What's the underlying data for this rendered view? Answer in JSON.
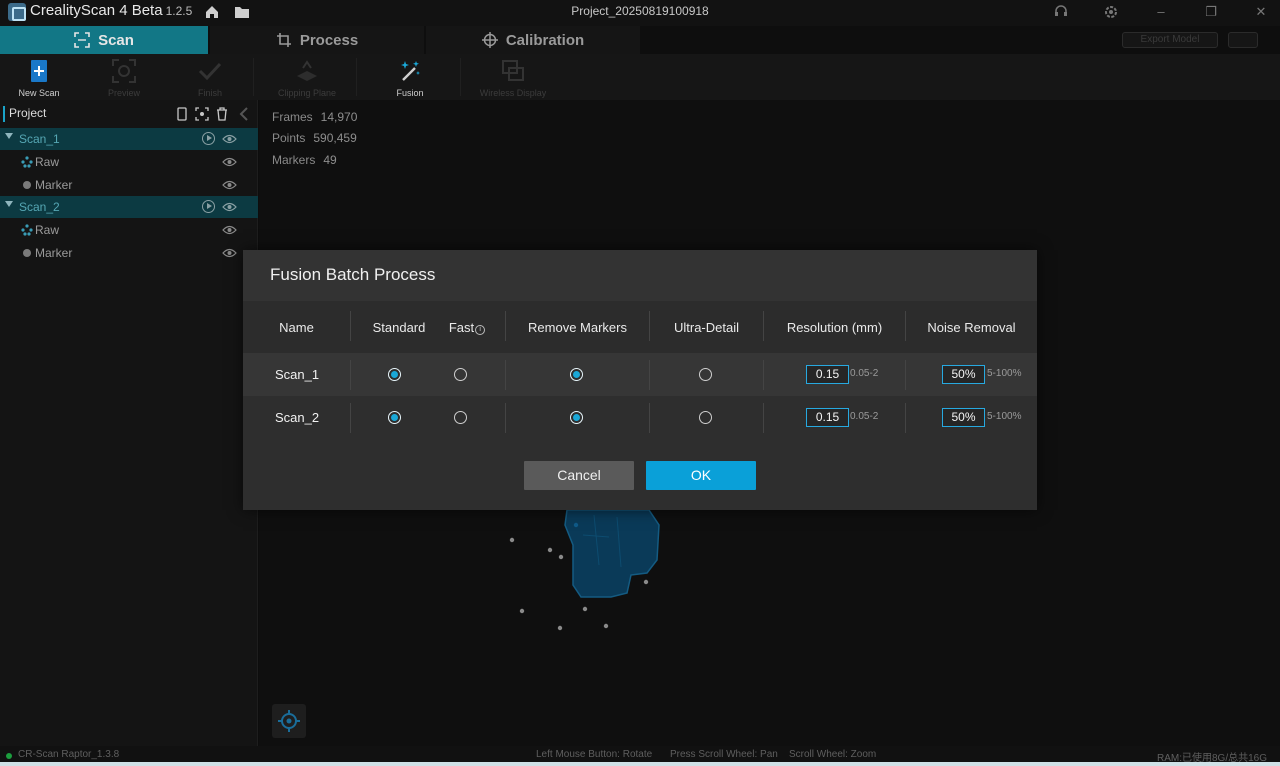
{
  "titlebar": {
    "app_name": "CrealityScan 4 Beta",
    "version": "1.2.5",
    "window_title": "Project_20250819100918"
  },
  "modes": {
    "scan": "Scan",
    "process": "Process",
    "calibration": "Calibration",
    "export": "Export Model"
  },
  "toolbar": {
    "new_scan": "New Scan",
    "preview": "Preview",
    "finish": "Finish",
    "clipping_plane": "Clipping Plane",
    "fusion": "Fusion",
    "wireless_display": "Wireless Display"
  },
  "sidebar": {
    "title": "Project",
    "scans": [
      {
        "name": "Scan_1",
        "children": [
          "Raw",
          "Marker"
        ]
      },
      {
        "name": "Scan_2",
        "children": [
          "Raw",
          "Marker"
        ]
      }
    ]
  },
  "stats": {
    "frames_label": "Frames",
    "frames_value": "14,970",
    "points_label": "Points",
    "points_value": "590,459",
    "markers_label": "Markers",
    "markers_value": "49"
  },
  "dialog": {
    "title": "Fusion Batch Process",
    "columns": {
      "name": "Name",
      "standard": "Standard",
      "fast": "Fast",
      "remove_markers": "Remove Markers",
      "ultra_detail": "Ultra-Detail",
      "resolution": "Resolution (mm)",
      "noise_removal": "Noise Removal"
    },
    "rows": [
      {
        "name": "Scan_1",
        "mode": "Standard",
        "remove_markers": true,
        "ultra_detail": false,
        "resolution": "0.15",
        "resolution_range": "0.05-2",
        "noise": "50%",
        "noise_range": "5-100%"
      },
      {
        "name": "Scan_2",
        "mode": "Standard",
        "remove_markers": true,
        "ultra_detail": false,
        "resolution": "0.15",
        "resolution_range": "0.05-2",
        "noise": "50%",
        "noise_range": "5-100%"
      }
    ],
    "cancel": "Cancel",
    "ok": "OK"
  },
  "statusbar": {
    "device": "CR-Scan Raptor_1.3.8",
    "hint_rotate": "Left Mouse Button: Rotate",
    "hint_pan": "Press Scroll Wheel: Pan",
    "hint_zoom": "Scroll Wheel: Zoom",
    "ram": "RAM:已使用8G/总共16G"
  },
  "colors": {
    "accent": "#0aa0d8",
    "scan_tab": "#127786",
    "selected_row": "#0c3a42"
  }
}
